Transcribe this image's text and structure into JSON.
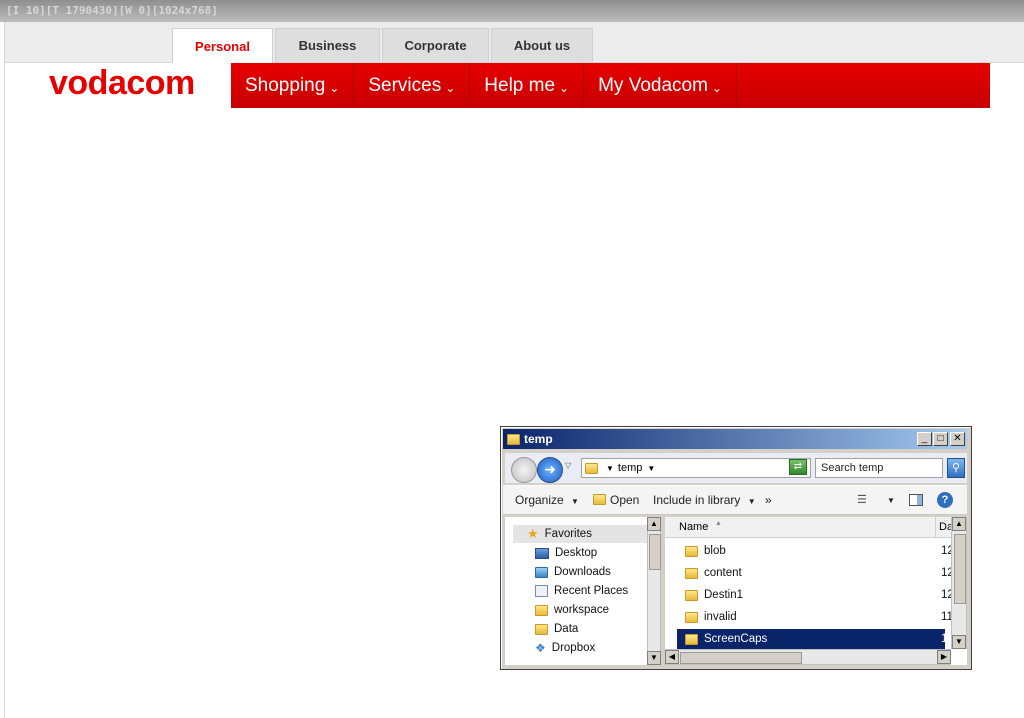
{
  "window_caption": "[I 10][T 1790430][W 0][1024x768]",
  "site": {
    "tabs": [
      {
        "label": "Personal"
      },
      {
        "label": "Business"
      },
      {
        "label": "Corporate"
      },
      {
        "label": "About us"
      }
    ],
    "logo": "vodacom",
    "nav": [
      {
        "label": "Shopping"
      },
      {
        "label": "Services"
      },
      {
        "label": "Help me"
      },
      {
        "label": "My Vodacom"
      }
    ],
    "colors": {
      "brand": "#e60000"
    }
  },
  "explorer": {
    "title": "temp",
    "address": "temp",
    "search_placeholder": "Search temp",
    "toolbar": {
      "organize": "Organize",
      "open": "Open",
      "include": "Include in library",
      "more": "»"
    },
    "nav_pane": {
      "favorites": "Favorites",
      "items": [
        "Desktop",
        "Downloads",
        "Recent Places",
        "workspace",
        "Data",
        "Dropbox"
      ]
    },
    "columns": {
      "name": "Name",
      "date": "Da"
    },
    "files": [
      {
        "name": "blob",
        "date": "12"
      },
      {
        "name": "content",
        "date": "12"
      },
      {
        "name": "Destin1",
        "date": "12"
      },
      {
        "name": "invalid",
        "date": "11"
      },
      {
        "name": "ScreenCaps",
        "date": "12"
      }
    ]
  }
}
